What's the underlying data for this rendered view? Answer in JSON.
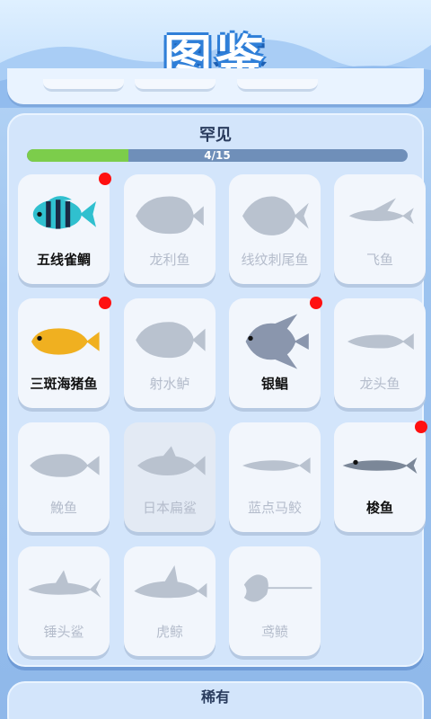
{
  "header": {
    "title": "图鉴"
  },
  "section": {
    "title": "罕见",
    "progress_text": "4/15",
    "progress_fraction": 0.2667
  },
  "next_section": {
    "title": "稀有"
  },
  "fish": [
    {
      "name": "五线雀鲷",
      "found": true,
      "new": true,
      "icon": "damselfish-icon"
    },
    {
      "name": "龙利鱼",
      "found": false,
      "new": false,
      "icon": "flatfish-icon"
    },
    {
      "name": "线纹刺尾鱼",
      "found": false,
      "new": false,
      "icon": "surgeonfish-icon"
    },
    {
      "name": "飞鱼",
      "found": false,
      "new": false,
      "icon": "flyingfish-icon"
    },
    {
      "name": "三斑海猪鱼",
      "found": true,
      "new": true,
      "icon": "wrasse-icon"
    },
    {
      "name": "射水鲈",
      "found": false,
      "new": false,
      "icon": "archerfish-icon"
    },
    {
      "name": "银鲳",
      "found": true,
      "new": true,
      "icon": "pomfret-icon"
    },
    {
      "name": "龙头鱼",
      "found": false,
      "new": false,
      "icon": "bombay-duck-icon"
    },
    {
      "name": "鮸鱼",
      "found": false,
      "new": false,
      "icon": "croaker-icon"
    },
    {
      "name": "日本扁鲨",
      "found": false,
      "new": false,
      "icon": "angelshark-icon"
    },
    {
      "name": "蓝点马鲛",
      "found": false,
      "new": false,
      "icon": "mackerel-icon"
    },
    {
      "name": "梭鱼",
      "found": true,
      "new": true,
      "icon": "barracuda-icon"
    },
    {
      "name": "锤头鲨",
      "found": false,
      "new": false,
      "icon": "hammerhead-icon"
    },
    {
      "name": "虎鲸",
      "found": false,
      "new": false,
      "icon": "orca-icon"
    },
    {
      "name": "鸢鲼",
      "found": false,
      "new": false,
      "icon": "eagle-ray-icon"
    }
  ],
  "colors": {
    "progress_fill": "#7ccd4b",
    "new_dot": "#ff1010",
    "silhouette": "#b9c2cf"
  }
}
